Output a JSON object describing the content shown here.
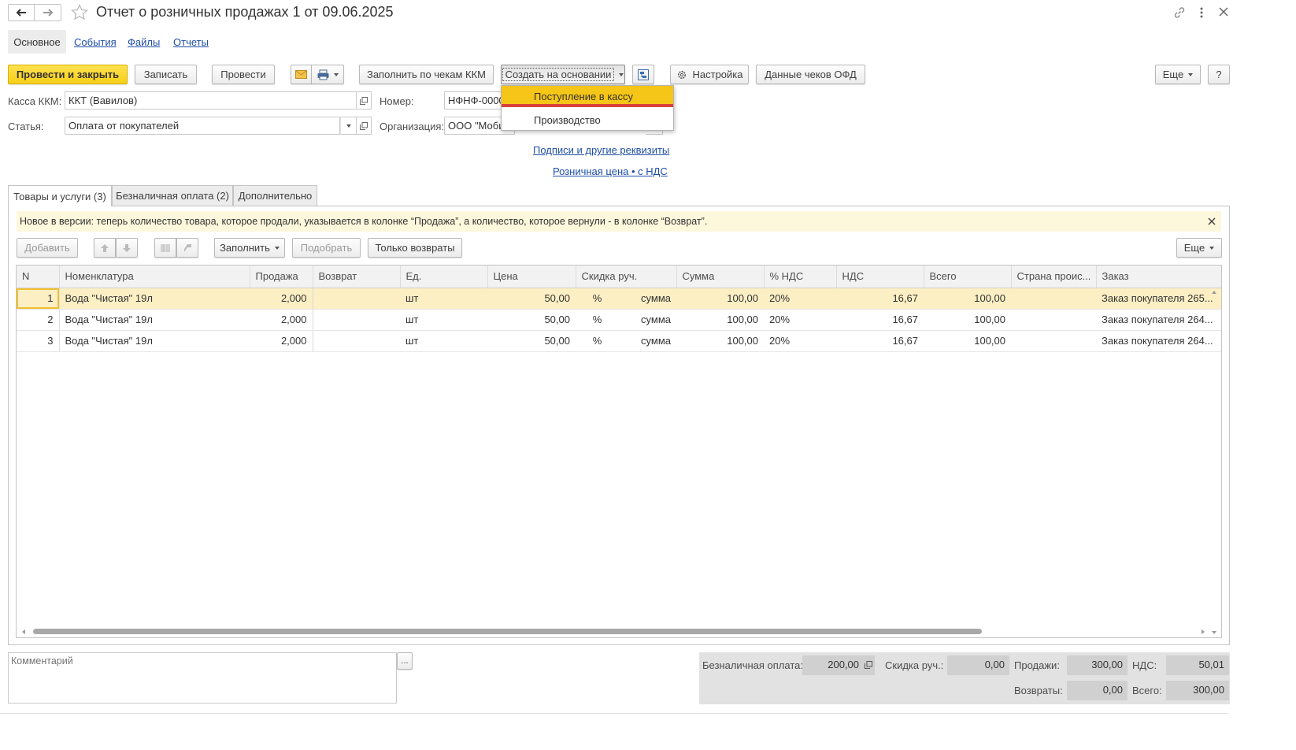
{
  "window": {
    "title": "Отчет о розничных продажах 1 от 09.06.2025"
  },
  "nav": {
    "main": "Основное",
    "events": "События",
    "files": "Файлы",
    "reports": "Отчеты"
  },
  "toolbar": {
    "post_close": "Провести и закрыть",
    "save": "Записать",
    "post": "Провести",
    "fill_kkm": "Заполнить по чекам ККМ",
    "create_based": "Создать на основании",
    "settings": "Настройка",
    "ofd_data": "Данные чеков ОФД",
    "more": "Еще",
    "help": "?"
  },
  "dropdown": {
    "items": [
      "Поступление в кассу",
      "Производство"
    ]
  },
  "form": {
    "kkm_label": "Касса ККМ:",
    "kkm_value": "ККТ (Вавилов)",
    "article_label": "Статья:",
    "article_value": "Оплата от покупателей",
    "number_label": "Номер:",
    "number_value": "НФНФ-000001",
    "org_label": "Организация:",
    "org_value": "ООО \"Мобильные решения\"",
    "signatures_link": "Подписи и другие реквизиты",
    "price_link": "Розничная цена • с НДС"
  },
  "tabs": [
    "Товары и услуги (3)",
    "Безналичная оплата (2)",
    "Дополнительно"
  ],
  "notice": "Новое в версии: теперь количество товара, которое продали, указывается в колонке “Продажа”, а количество, которое вернули - в колонке “Возврат”.",
  "table_toolbar": {
    "add": "Добавить",
    "fill": "Заполнить",
    "pick": "Подобрать",
    "returns_only": "Только возвраты",
    "more": "Еще"
  },
  "table": {
    "headers": [
      "N",
      "Номенклатура",
      "Продажа",
      "Возврат",
      "Ед.",
      "Цена",
      "Скидка руч.",
      "",
      "Сумма",
      "% НДС",
      "НДС",
      "Всего",
      "Страна проис...",
      "Заказ"
    ],
    "rows": [
      [
        "1",
        "Вода \"Чистая\" 19л",
        "2,000",
        "",
        "шт",
        "50,00",
        "%",
        "сумма",
        "100,00",
        "20%",
        "16,67",
        "100,00",
        "",
        "Заказ покупателя 265..."
      ],
      [
        "2",
        "Вода \"Чистая\" 19л",
        "2,000",
        "",
        "шт",
        "50,00",
        "%",
        "сумма",
        "100,00",
        "20%",
        "16,67",
        "100,00",
        "",
        "Заказ покупателя 264..."
      ],
      [
        "3",
        "Вода \"Чистая\" 19л",
        "2,000",
        "",
        "шт",
        "50,00",
        "%",
        "сумма",
        "100,00",
        "20%",
        "16,67",
        "100,00",
        "",
        "Заказ покупателя 264..."
      ]
    ],
    "selected_row": 0
  },
  "comment": {
    "placeholder": "Комментарий",
    "button": "..."
  },
  "totals": {
    "cashless_label": "Безналичная оплата:",
    "cashless_value": "200,00",
    "discount_label": "Скидка руч.:",
    "discount_value": "0,00",
    "sales_label": "Продажи:",
    "sales_value": "300,00",
    "vat_label": "НДС:",
    "vat_value": "50,01",
    "returns_label": "Возвраты:",
    "returns_value": "0,00",
    "total_label": "Всего:",
    "total_value": "300,00"
  },
  "colors": {
    "primary_button": "#f5cf17",
    "selected_row": "#fcefc4",
    "notice_bg": "#fdf7dc",
    "link": "#1f4ea6",
    "dropdown_highlight": "#f5c518",
    "dropdown_underline": "#d9423a"
  }
}
